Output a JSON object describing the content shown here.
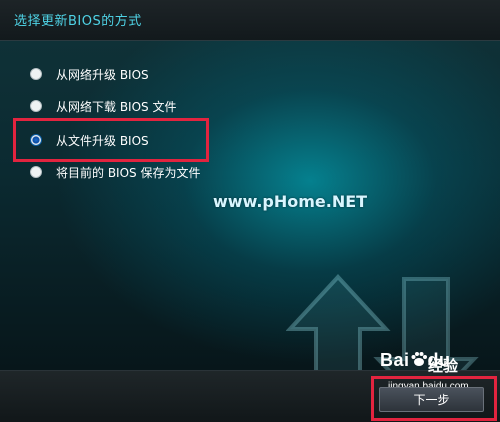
{
  "dialog": {
    "title": "选择更新BIOS的方式"
  },
  "options": [
    {
      "label": "从网络升级 BIOS",
      "selected": false
    },
    {
      "label": "从网络下载 BIOS 文件",
      "selected": false
    },
    {
      "label": "从文件升级 BIOS",
      "selected": true
    },
    {
      "label": "将目前的 BIOS 保存为文件",
      "selected": false
    }
  ],
  "watermark": "www.pHome.NET",
  "footer": {
    "next_label": "下一步"
  },
  "baidu": {
    "logo_text": "Bai",
    "logo_text2": "du",
    "logo_cn": "经验",
    "url": "jingyan.baidu.com"
  },
  "colors": {
    "title": "#4fd3e6",
    "highlight": "#e2243f",
    "panel_glow": "#00c8dc"
  },
  "icons": {
    "background_arrows": "up-down-arrows-icon",
    "baidu_paw": "paw-icon"
  }
}
